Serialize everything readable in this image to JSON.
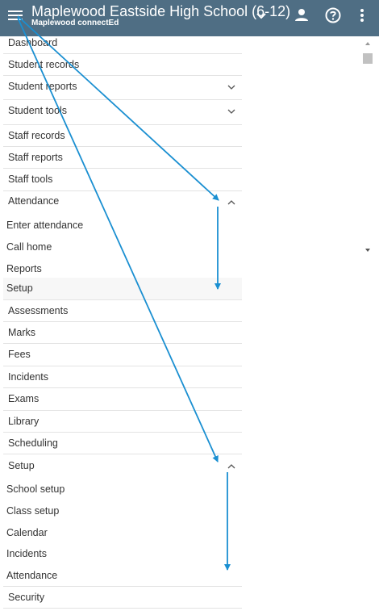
{
  "header": {
    "title": "Maplewood Eastside High School (6-12)",
    "subtitle": "Maplewood connectEd",
    "menu_icon": "hamburger-menu-icon",
    "bg_color": "#4f6e84"
  },
  "nav": {
    "items": [
      {
        "label": "Dashboard"
      },
      {
        "label": "Student records"
      },
      {
        "label": "Student reports",
        "chevron": "down"
      },
      {
        "label": "Student tools",
        "chevron": "down"
      },
      {
        "label": "Staff records"
      },
      {
        "label": "Staff reports"
      },
      {
        "label": "Staff tools"
      },
      {
        "label": "Attendance",
        "chevron": "up"
      },
      {
        "label": "Enter attendance"
      },
      {
        "label": "Call home"
      },
      {
        "label": "Reports"
      },
      {
        "label": "Setup"
      },
      {
        "label": "Assessments"
      },
      {
        "label": "Marks"
      },
      {
        "label": "Fees"
      },
      {
        "label": "Incidents"
      },
      {
        "label": "Exams"
      },
      {
        "label": "Library"
      },
      {
        "label": "Scheduling"
      },
      {
        "label": "Setup",
        "chevron": "up"
      },
      {
        "label": "School setup"
      },
      {
        "label": "Class setup"
      },
      {
        "label": "Calendar"
      },
      {
        "label": "Incidents"
      },
      {
        "label": "Attendance"
      },
      {
        "label": "Security"
      }
    ]
  },
  "annotation_color": "#1a8fd1"
}
